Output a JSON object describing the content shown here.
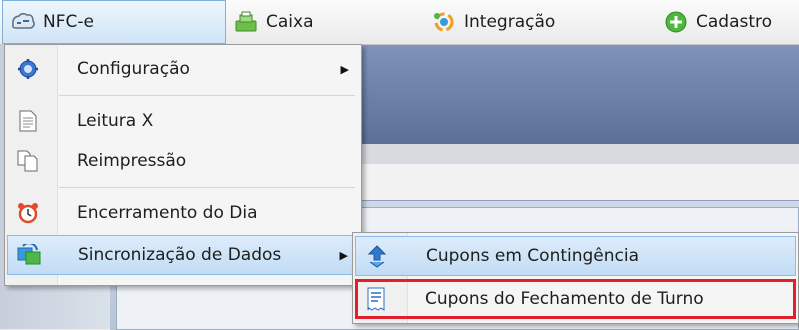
{
  "menubar": {
    "items": [
      {
        "label": "NFC-e",
        "icon": "nfce-icon"
      },
      {
        "label": "Caixa",
        "icon": "cash-register-icon"
      },
      {
        "label": "Integração",
        "icon": "integration-icon"
      },
      {
        "label": "Cadastro",
        "icon": "add-circle-icon"
      }
    ]
  },
  "nfce_menu": {
    "items": [
      {
        "label": "Configuração",
        "icon": "gear-icon"
      },
      {
        "label": "Leitura X",
        "icon": "document-icon"
      },
      {
        "label": "Reimpressão",
        "icon": "copy-icon"
      },
      {
        "label": "Encerramento do Dia",
        "icon": "alarm-clock-icon"
      },
      {
        "label": "Sincronização de Dados",
        "icon": "sync-icon"
      }
    ],
    "submenu_arrow": "▶"
  },
  "sync_submenu": {
    "items": [
      {
        "label": "Cupons em Contingência",
        "icon": "download-arrow-icon"
      },
      {
        "label": "Cupons do Fechamento de Turno",
        "icon": "receipt-icon"
      }
    ]
  },
  "colors": {
    "highlight_border": "#e0202a",
    "menu_highlight": "#c2dcf4"
  }
}
